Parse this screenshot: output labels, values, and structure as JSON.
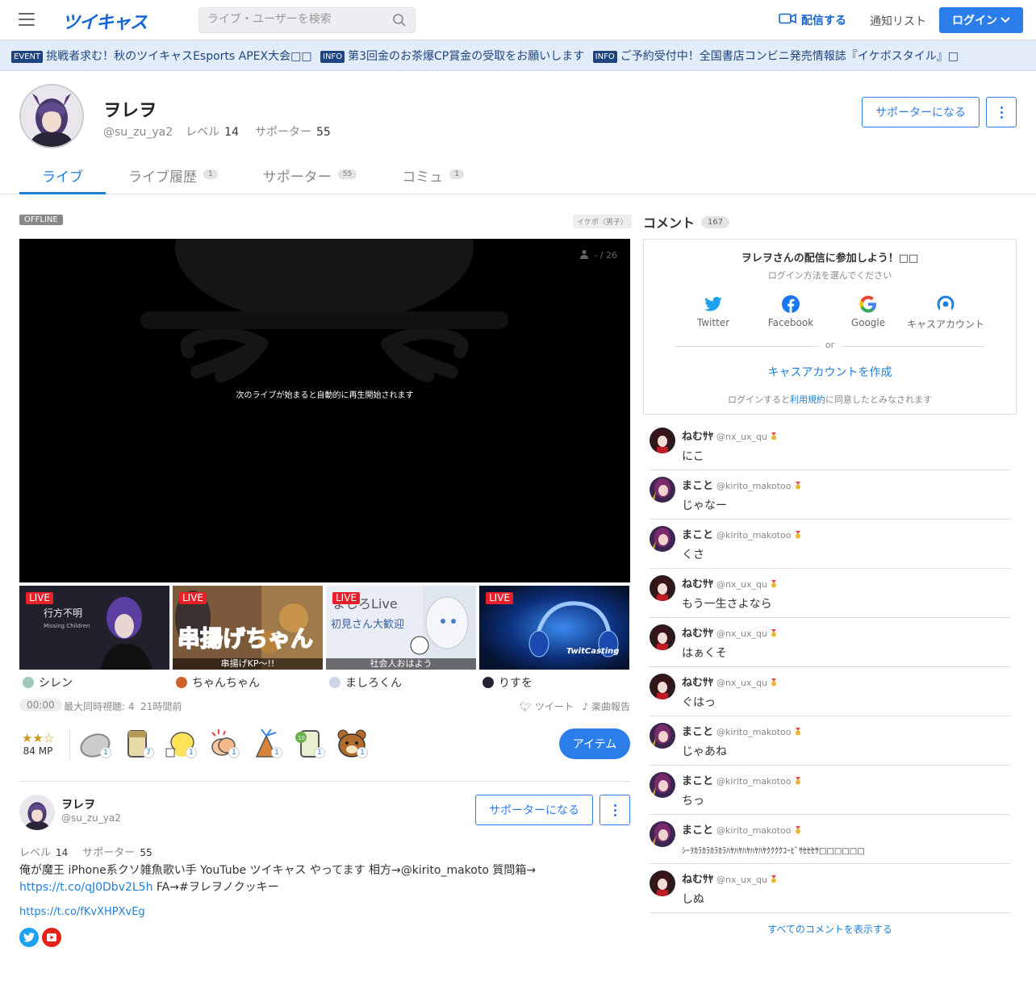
{
  "header": {
    "logo": "ツイキャス",
    "search_placeholder": "ライブ・ユーザーを検索",
    "live_label": "配信する",
    "notice_label": "通知リスト",
    "login_label": "ログイン",
    "accent": "#2b7de9"
  },
  "ticker": [
    {
      "tag": "EVENT",
      "text": "挑戦者求む！秋のツイキャスEsports APEX大会□□"
    },
    {
      "tag": "INFO",
      "text": "第3回金のお茶爆CP賞金の受取をお願いします"
    },
    {
      "tag": "INFO",
      "text": "ご予約受付中！全国書店コンビニ発売情報誌『イケボスタイル』□"
    }
  ],
  "profile": {
    "name": "ヲレヲ",
    "handle": "@su_zu_ya2",
    "level_label": "レベル",
    "level": "14",
    "supporter_label": "サポーター",
    "supporters": "55",
    "support_button": "サポーターになる"
  },
  "tabs": [
    {
      "label": "ライブ",
      "count": ""
    },
    {
      "label": "ライブ履歴",
      "count": "1"
    },
    {
      "label": "サポーター",
      "count": "55"
    },
    {
      "label": "コミュ",
      "count": "1"
    }
  ],
  "player": {
    "status": "OFFLINE",
    "category": "イケボ（男子）",
    "viewers": "- / 26",
    "message": "次のライブが始まると自動的に再生開始されます"
  },
  "live_thumbs": [
    {
      "badge": "LIVE",
      "caption": "",
      "user": "シレン"
    },
    {
      "badge": "LIVE",
      "caption": "串揚げKP〜!!",
      "user": "ちゃんちゃん"
    },
    {
      "badge": "LIVE",
      "caption": "社会人おはよう",
      "user": "ましろくん"
    },
    {
      "badge": "LIVE",
      "caption": "",
      "user": "りすを"
    }
  ],
  "meta": {
    "time": "00:00",
    "max_viewers": "最大同時視聴: 4",
    "ago": "21時間前",
    "tweet": "ツイート",
    "music": "楽曲報告"
  },
  "gifts": {
    "mp": "84 MP",
    "counts": [
      "1",
      "7",
      "1",
      "1",
      "1",
      "1",
      "1"
    ],
    "item_button": "アイテム"
  },
  "about": {
    "name": "ヲレヲ",
    "handle": "@su_zu_ya2",
    "level_label": "レベル",
    "level": "14",
    "supporter_label": "サポーター",
    "supporters": "55",
    "support_button": "サポーターになる",
    "bio": "俺が魔王 iPhone系クソ雑魚歌い手 YouTube ツイキャス やってます 相方→@kirito_makoto 質問箱→ ",
    "bio_link": "https://t.co/qJ0Dbv2L5h",
    "bio_tail": " FA→#ヲレヲノクッキー",
    "url": "https://t.co/fKvXHPXvEg"
  },
  "comments_panel": {
    "title": "コメント",
    "count": "167",
    "join_title": "ヲレヲさんの配信に参加しよう！□□",
    "join_sub": "ログイン方法を選んでください",
    "providers": [
      "Twitter",
      "Facebook",
      "Google",
      "キャスアカウント"
    ],
    "or": "or",
    "make_account": "キャスアカウントを作成",
    "terms_pre": "ログインすると",
    "terms_link": "利用規約",
    "terms_post": "に同意したとみなされます",
    "show_all": "すべてのコメントを表示する"
  },
  "comments": [
    {
      "name": "ねむｻﾔ",
      "id": "@nx_ux_qu",
      "text": "にこ"
    },
    {
      "name": "まこと",
      "id": "@kirito_makotoo",
      "text": "じゃなー"
    },
    {
      "name": "まこと",
      "id": "@kirito_makotoo",
      "text": "くさ"
    },
    {
      "name": "ねむｻﾔ",
      "id": "@nx_ux_qu",
      "text": "もう一生さよなら"
    },
    {
      "name": "ねむｻﾔ",
      "id": "@nx_ux_qu",
      "text": "はぁくそ"
    },
    {
      "name": "ねむｻﾔ",
      "id": "@nx_ux_qu",
      "text": "ぐはっ"
    },
    {
      "name": "まこと",
      "id": "@kirito_makotoo",
      "text": "じゃあね"
    },
    {
      "name": "まこと",
      "id": "@kirito_makotoo",
      "text": "ちっ"
    },
    {
      "name": "まこと",
      "id": "@kirito_makotoo",
      "text": "ｼｰｦｶﾗｶﾗｶﾗｶﾗﾊﾔﾊﾔﾊﾔﾊﾔﾊﾔｸｸｸｸｺｰﾋﾞｻｾｾｾｻ□□□□□□"
    },
    {
      "name": "ねむｻﾔ",
      "id": "@nx_ux_qu",
      "text": "しぬ"
    }
  ]
}
